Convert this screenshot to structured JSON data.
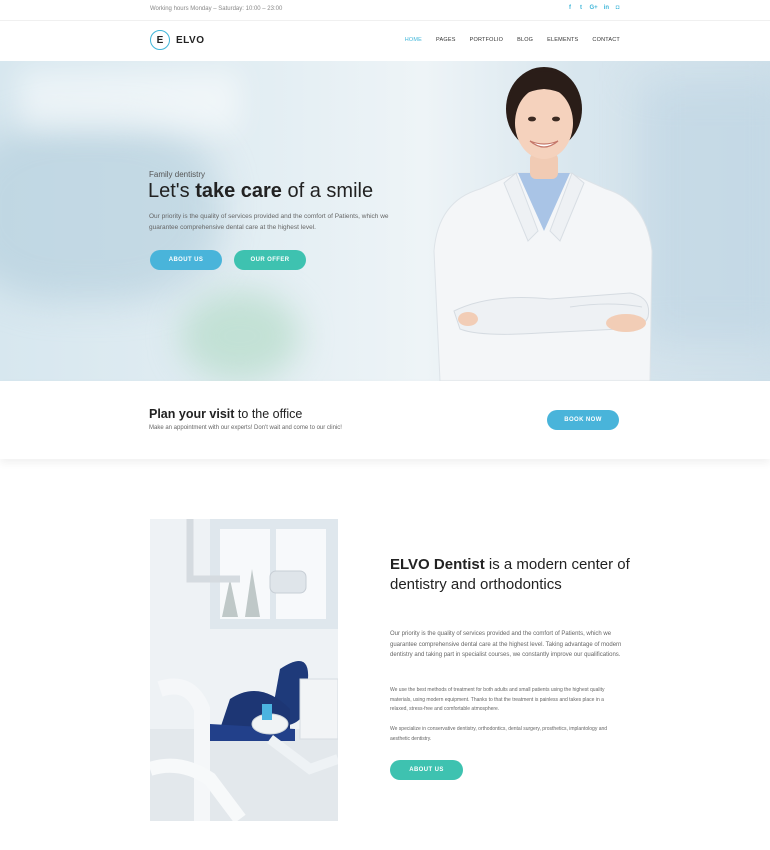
{
  "topbar": {
    "hours": "Working hours Monday – Saturday: 10:00 – 23:00",
    "social": [
      {
        "icon": "facebook-icon",
        "glyph": "f"
      },
      {
        "icon": "twitter-icon",
        "glyph": "t"
      },
      {
        "icon": "google-plus-icon",
        "glyph": "G+"
      },
      {
        "icon": "linkedin-icon",
        "glyph": "in"
      },
      {
        "icon": "instagram-icon",
        "glyph": "◘"
      }
    ]
  },
  "nav": {
    "logo_letter": "E",
    "logo_text": "ELVO",
    "items": [
      "HOME",
      "PAGES",
      "PORTFOLIO",
      "BLOG",
      "ELEMENTS",
      "CONTACT"
    ],
    "active": "HOME"
  },
  "hero": {
    "subtitle": "Family dentistry",
    "title_pre": "Let's ",
    "title_bold": "take care",
    "title_post": " of a smile",
    "desc": "Our priority is the quality of services provided and the comfort of Patients, which we guarantee comprehensive dental care at the highest level.",
    "btn_about": "ABOUT US",
    "btn_offer": "OUR OFFER"
  },
  "cta": {
    "title_bold": "Plan your visit",
    "title_rest": " to the office",
    "text": "Make an appointment with our experts! Don't wait and come to our clinic!",
    "button": "BOOK NOW"
  },
  "about": {
    "title_bold": "ELVO Dentist",
    "title_rest": " is a modern center of dentistry and orthodontics",
    "p1": "Our priority is the quality of services provided and the comfort of Patients, which we guarantee comprehensive dental care at the highest level. Taking advantage of modern dentistry and taking part in specialist courses, we constantly improve our qualifications.",
    "p2": "We use the best methods of treatment for both adults and small patients using the highest quality materials, using modern equipment. Thanks to that the treatment is painless and takes place in a relaxed, stress-free and comfortable atmosphere.",
    "p3": "We specialize in conservative dentistry, orthodontics, dental surgery, prosthetics, implantology and aesthetic dentistry.",
    "button": "ABOUT US"
  },
  "colors": {
    "accent_blue": "#49b4da",
    "accent_teal": "#3ec2b0"
  }
}
